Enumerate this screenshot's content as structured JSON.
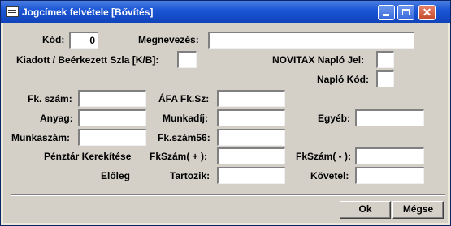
{
  "window": {
    "title": "Jogcímek felvétele [Bővítés]",
    "minimize_icon": "minimize-icon",
    "maximize_icon": "maximize-icon",
    "close_icon": "close-icon",
    "close_glyph": "✕"
  },
  "form": {
    "kod_label": "Kód:",
    "kod_value": "0",
    "megnevezes_label": "Megnevezés:",
    "megnevezes_value": "",
    "kiadott_label": "Kiadott / Beérkezett Szla [K/B]:",
    "kiadott_value": "",
    "novitax_label": "NOVITAX Napló Jel:",
    "novitax_value": "",
    "naplo_kod_label": "Napló Kód:",
    "naplo_kod_value": "",
    "fk_szam_label": "Fk. szám:",
    "fk_szam_value": "",
    "afa_label": "ÁFA Fk.Sz:",
    "afa_value": "",
    "anyag_label": "Anyag:",
    "anyag_value": "",
    "munkadij_label": "Munkadíj:",
    "munkadij_value": "",
    "egyeb_label": "Egyéb:",
    "egyeb_value": "",
    "munkaszam_label": "Munkaszám:",
    "munkaszam_value": "",
    "fkszam56_label": "Fk.szám56:",
    "fkszam56_value": "",
    "penztar_label": "Pénztár Kerekítése",
    "fkszam_plus_label": "FkSzám( + ):",
    "fkszam_plus_value": "",
    "fkszam_minus_label": "FkSzám( - ):",
    "fkszam_minus_value": "",
    "eloleg_label": "Előleg",
    "tartozik_label": "Tartozik:",
    "tartozik_value": "",
    "kovetel_label": "Követel:",
    "kovetel_value": ""
  },
  "buttons": {
    "ok_label": "Ok",
    "cancel_label": "Mégse"
  }
}
